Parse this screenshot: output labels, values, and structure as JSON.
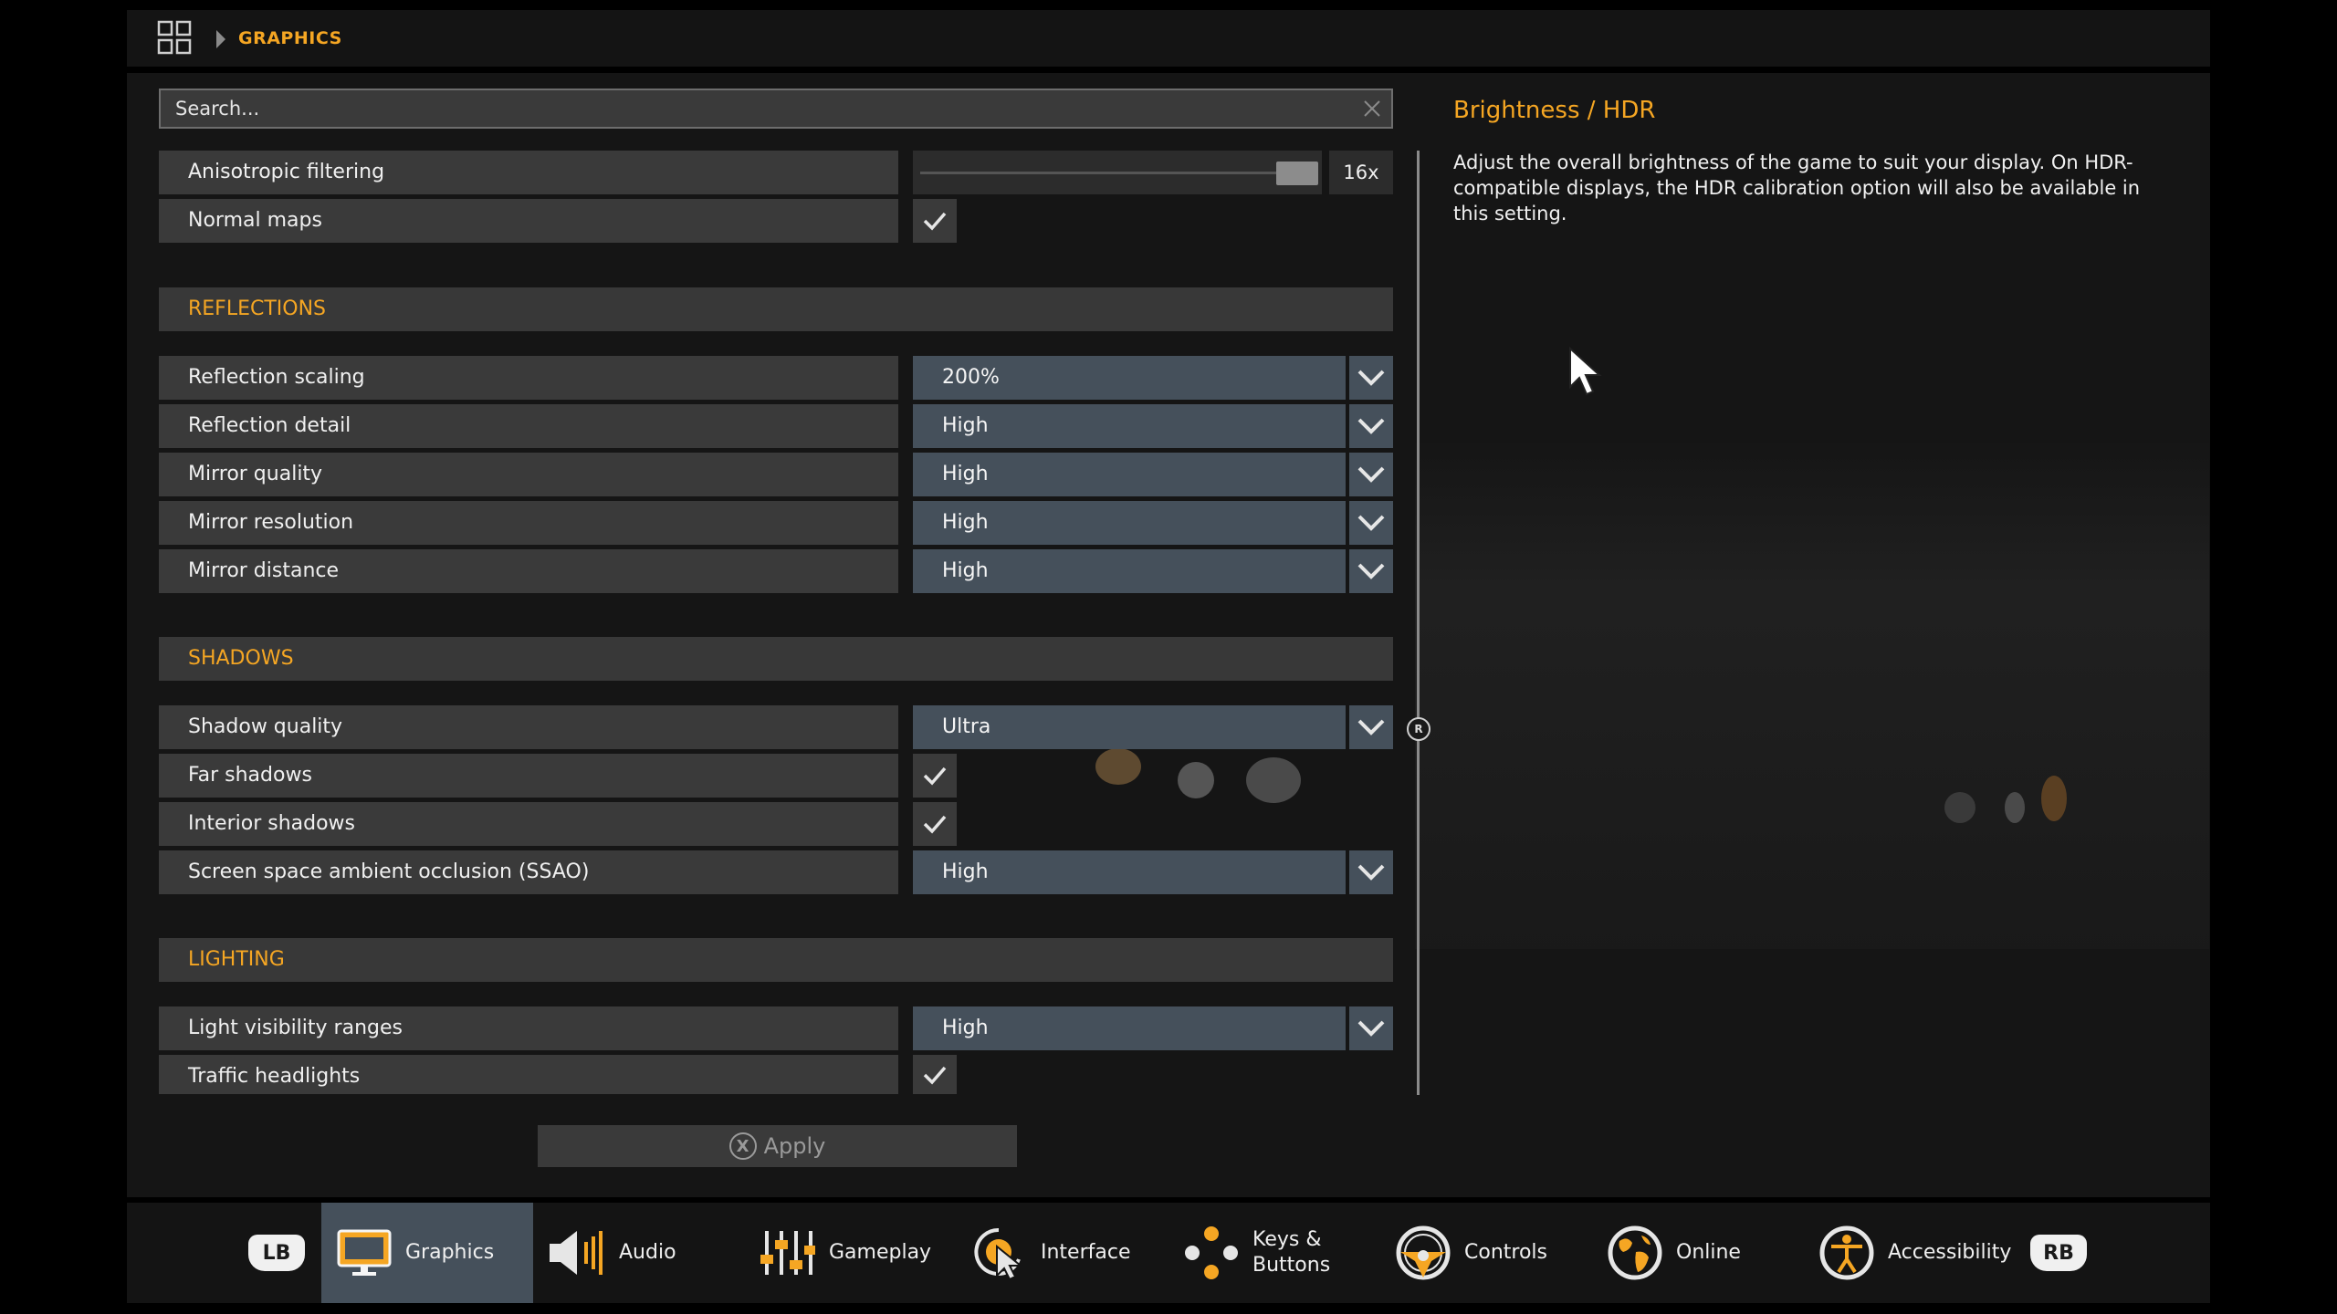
{
  "breadcrumb": {
    "current": "GRAPHICS"
  },
  "search": {
    "placeholder": "Search..."
  },
  "settings": {
    "anisotropic": {
      "label": "Anisotropic filtering",
      "value": "16x",
      "level_fraction": 0.95
    },
    "normal_maps": {
      "label": "Normal maps",
      "checked": true
    },
    "sections": {
      "reflections": "REFLECTIONS",
      "shadows": "SHADOWS",
      "lighting": "LIGHTING"
    },
    "reflection_scaling": {
      "label": "Reflection scaling",
      "value": "200%"
    },
    "reflection_detail": {
      "label": "Reflection detail",
      "value": "High"
    },
    "mirror_quality": {
      "label": "Mirror quality",
      "value": "High"
    },
    "mirror_resolution": {
      "label": "Mirror resolution",
      "value": "High"
    },
    "mirror_distance": {
      "label": "Mirror distance",
      "value": "High"
    },
    "shadow_quality": {
      "label": "Shadow quality",
      "value": "Ultra"
    },
    "far_shadows": {
      "label": "Far shadows",
      "checked": true
    },
    "interior_shadows": {
      "label": "Interior shadows",
      "checked": true
    },
    "ssao": {
      "label": "Screen space ambient occlusion (SSAO)",
      "value": "High"
    },
    "light_visibility": {
      "label": "Light visibility ranges",
      "value": "High"
    },
    "traffic_headlights": {
      "label": "Traffic headlights",
      "checked": true
    }
  },
  "scroll_knob_label": "R",
  "description": {
    "title": "Brightness / HDR",
    "body": "Adjust the overall brightness of the game to suit your display. On HDR-compatible displays, the HDR calibration option will also be available in this setting."
  },
  "apply": {
    "label": "Apply",
    "button_glyph": "X"
  },
  "bumpers": {
    "left": "LB",
    "right": "RB"
  },
  "tabs": [
    {
      "label": "Graphics",
      "icon": "monitor-icon",
      "active": true
    },
    {
      "label": "Audio",
      "icon": "speaker-icon",
      "active": false
    },
    {
      "label": "Gameplay",
      "icon": "sliders-icon",
      "active": false
    },
    {
      "label": "Interface",
      "icon": "pointer-icon",
      "active": false
    },
    {
      "label": "Keys &\nButtons",
      "icon": "buttons-icon",
      "active": false
    },
    {
      "label": "Controls",
      "icon": "steering-wheel-icon",
      "active": false
    },
    {
      "label": "Online",
      "icon": "globe-icon",
      "active": false
    },
    {
      "label": "Accessibility",
      "icon": "accessibility-icon",
      "active": false
    }
  ],
  "colors": {
    "accent": "#f5a623",
    "dropdown": "#45505b",
    "row": "#3a3a3a",
    "panel": "#151515"
  }
}
